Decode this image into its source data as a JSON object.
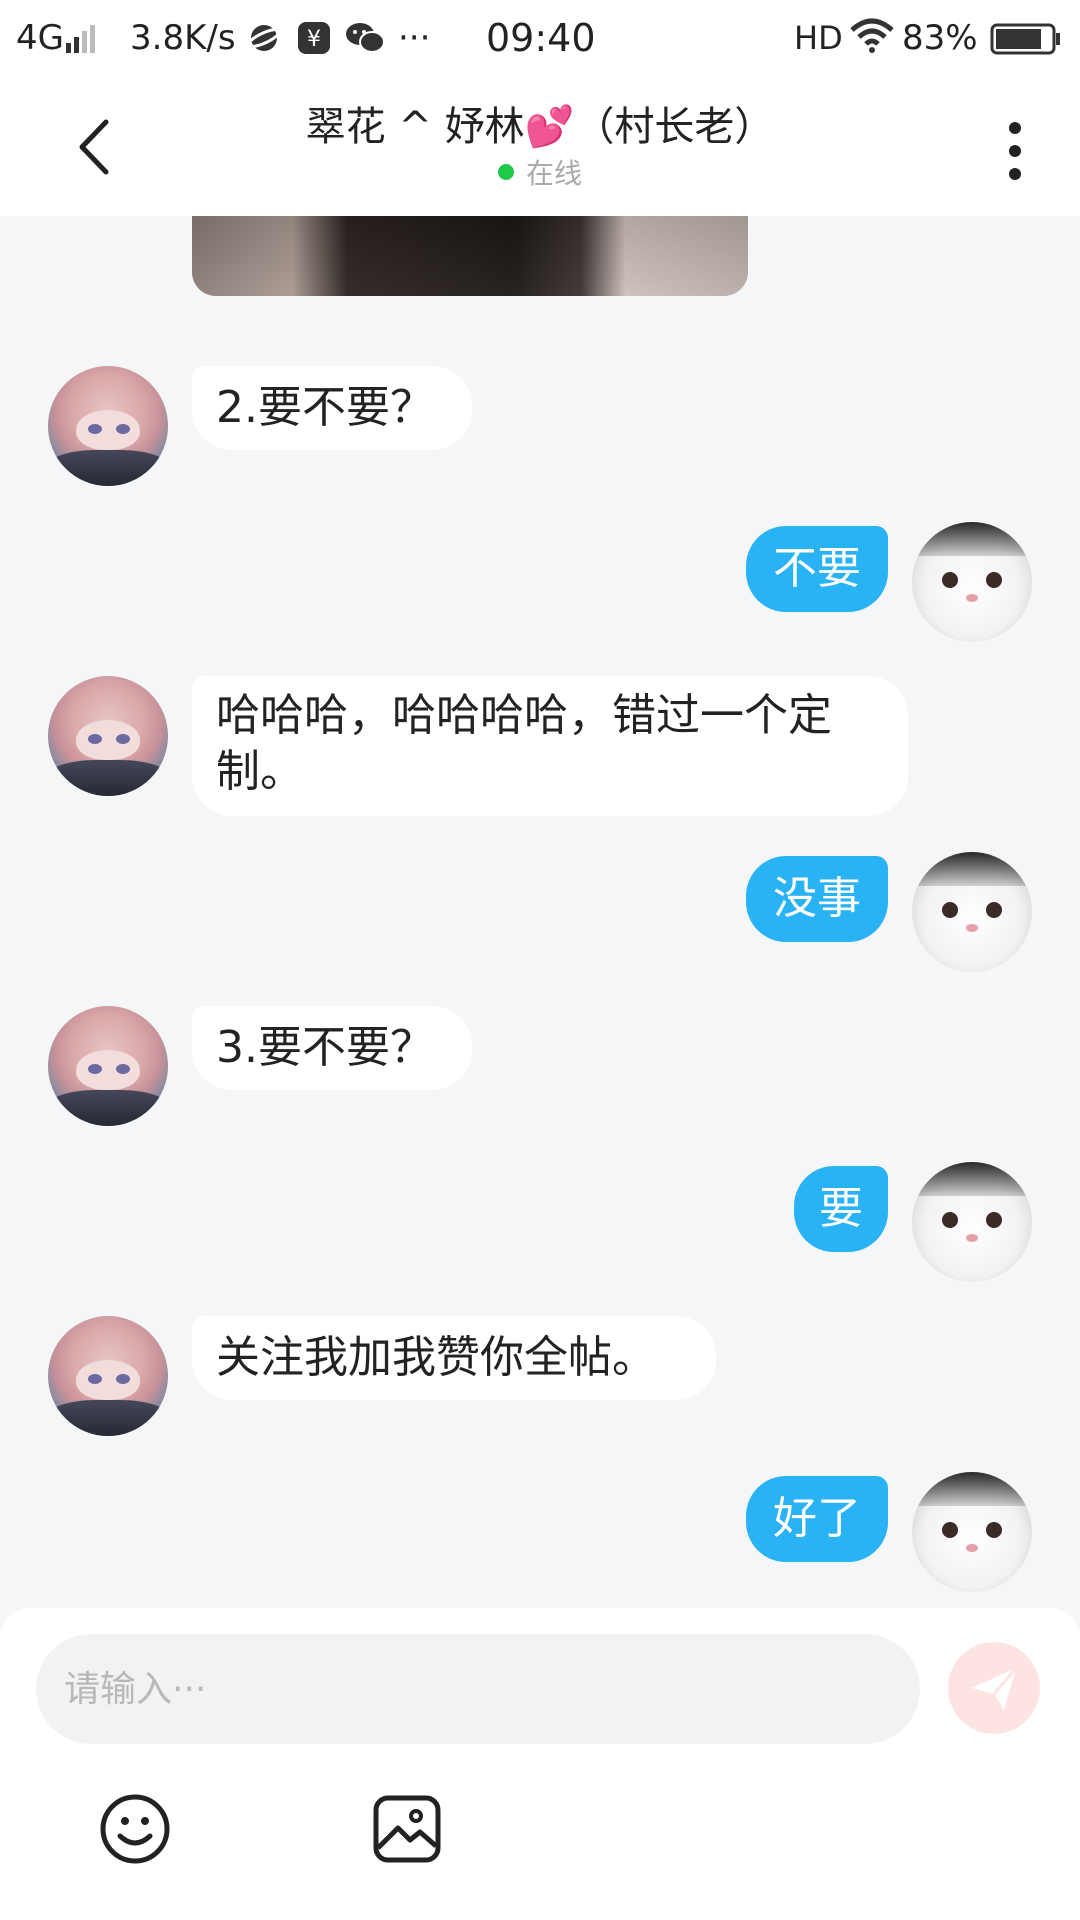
{
  "status_bar": {
    "network": "4G",
    "speed": "3.8K/s",
    "more": "···",
    "time": "09:40",
    "hd": "HD",
    "battery": "83%",
    "battery_level": 0.83
  },
  "header": {
    "title": "翠花 ^ 妤林💕（村长老）",
    "online_status": "在线"
  },
  "messages": [
    {
      "side": "in",
      "text": "2.要不要？"
    },
    {
      "side": "out",
      "text": "不要"
    },
    {
      "side": "in",
      "text": "哈哈哈，哈哈哈哈，错过一个定制。"
    },
    {
      "side": "out",
      "text": "没事"
    },
    {
      "side": "in",
      "text": "3.要不要？"
    },
    {
      "side": "out",
      "text": "要"
    },
    {
      "side": "in",
      "text": "关注我加我赞你全帖。"
    },
    {
      "side": "out",
      "text": "好了"
    }
  ],
  "input": {
    "placeholder": "请输入···",
    "value": ""
  },
  "colors": {
    "outgoing_bubble": "#29b3f5",
    "incoming_bubble": "#ffffff",
    "online_dot": "#22c84a",
    "send_button": "#fde4e2",
    "background": "#f4f6f8"
  },
  "icons": {
    "back": "back-arrow-icon",
    "more": "more-vertical-icon",
    "send": "paper-plane-icon",
    "emoji": "smiley-icon",
    "image": "image-icon"
  }
}
